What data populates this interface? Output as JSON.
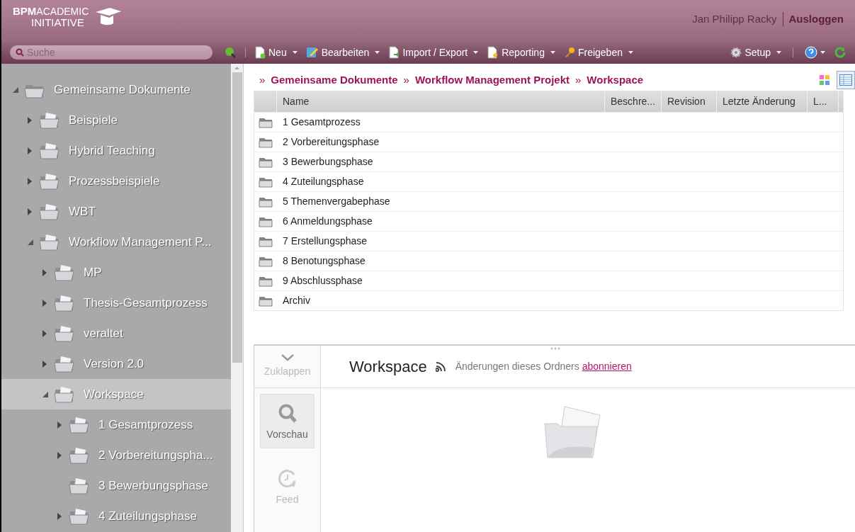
{
  "header": {
    "logo": {
      "bold": "BPM",
      "light": "ACADEMIC",
      "line2": "INITIATIVE"
    },
    "user": "Jan Philipp Racky",
    "logout": "Ausloggen"
  },
  "toolbar": {
    "search": {
      "placeholder": "Suche"
    },
    "menus": [
      {
        "label": "Neu",
        "kind": "new"
      },
      {
        "label": "Bearbeiten",
        "kind": "edit"
      },
      {
        "label": "Import / Export",
        "kind": "import"
      },
      {
        "label": "Reporting",
        "kind": "report"
      },
      {
        "label": "Freigeben",
        "kind": "share"
      }
    ],
    "setup": "Setup"
  },
  "tree": [
    {
      "label": "Gemeinsame Dokumente",
      "expanded": true,
      "leaf": false,
      "selected": false,
      "children": [
        {
          "label": "Beispiele",
          "expanded": false,
          "leaf": false,
          "selected": false
        },
        {
          "label": "Hybrid Teaching",
          "expanded": false,
          "leaf": false,
          "selected": false
        },
        {
          "label": "Prozessbeispiele",
          "expanded": false,
          "leaf": false,
          "selected": false
        },
        {
          "label": "WBT",
          "expanded": false,
          "leaf": false,
          "selected": false
        },
        {
          "label": "Workflow Management P...",
          "expanded": true,
          "leaf": false,
          "selected": false,
          "children": [
            {
              "label": "MP",
              "expanded": false,
              "leaf": false,
              "selected": false
            },
            {
              "label": "Thesis-Gesamtprozess",
              "expanded": false,
              "leaf": false,
              "selected": false
            },
            {
              "label": "veraltet",
              "expanded": false,
              "leaf": false,
              "selected": false
            },
            {
              "label": "Version 2.0",
              "expanded": false,
              "leaf": false,
              "selected": false
            },
            {
              "label": "Workspace",
              "expanded": true,
              "leaf": false,
              "selected": true,
              "children": [
                {
                  "label": "1 Gesamtprozess",
                  "expanded": false,
                  "leaf": false,
                  "selected": false
                },
                {
                  "label": "2 Vorbereitungspha...",
                  "expanded": false,
                  "leaf": false,
                  "selected": false
                },
                {
                  "label": "3 Bewerbungsphase",
                  "expanded": false,
                  "leaf": true,
                  "selected": false
                },
                {
                  "label": "4 Zuteilungsphase",
                  "expanded": false,
                  "leaf": false,
                  "selected": false
                }
              ]
            }
          ]
        }
      ]
    }
  ],
  "breadcrumb": [
    {
      "sep": "»",
      "label": "Gemeinsame Dokumente"
    },
    {
      "sep": "»",
      "label": "Workflow Management Projekt"
    },
    {
      "sep": "»",
      "label": "Workspace"
    }
  ],
  "view_modes": [
    {
      "kind": "tiles",
      "selected": false
    },
    {
      "kind": "list",
      "selected": true
    }
  ],
  "table": {
    "columns": [
      "Name",
      "Beschre...",
      "Revision",
      "Letzte Änderung",
      "L..."
    ],
    "rows": [
      {
        "name": "1 Gesamtprozess"
      },
      {
        "name": "2 Vorbereitungsphase"
      },
      {
        "name": "3 Bewerbungsphase"
      },
      {
        "name": "4 Zuteilungsphase"
      },
      {
        "name": "5 Themenvergabephase"
      },
      {
        "name": "6 Anmeldungsphase"
      },
      {
        "name": "7 Erstellungsphase"
      },
      {
        "name": "8 Benotungsphase"
      },
      {
        "name": "9 Abschlussphase"
      },
      {
        "name": "Archiv"
      }
    ]
  },
  "detail": {
    "tabs": [
      {
        "label": "Zuklappen",
        "kind": "collapse",
        "selected": false
      },
      {
        "label": "Vorschau",
        "kind": "preview",
        "selected": true
      },
      {
        "label": "Feed",
        "kind": "feed",
        "selected": false
      }
    ],
    "title": "Workspace",
    "subscribe_text": "Änderungen dieses Ordners",
    "subscribe_link": "abonnieren"
  }
}
